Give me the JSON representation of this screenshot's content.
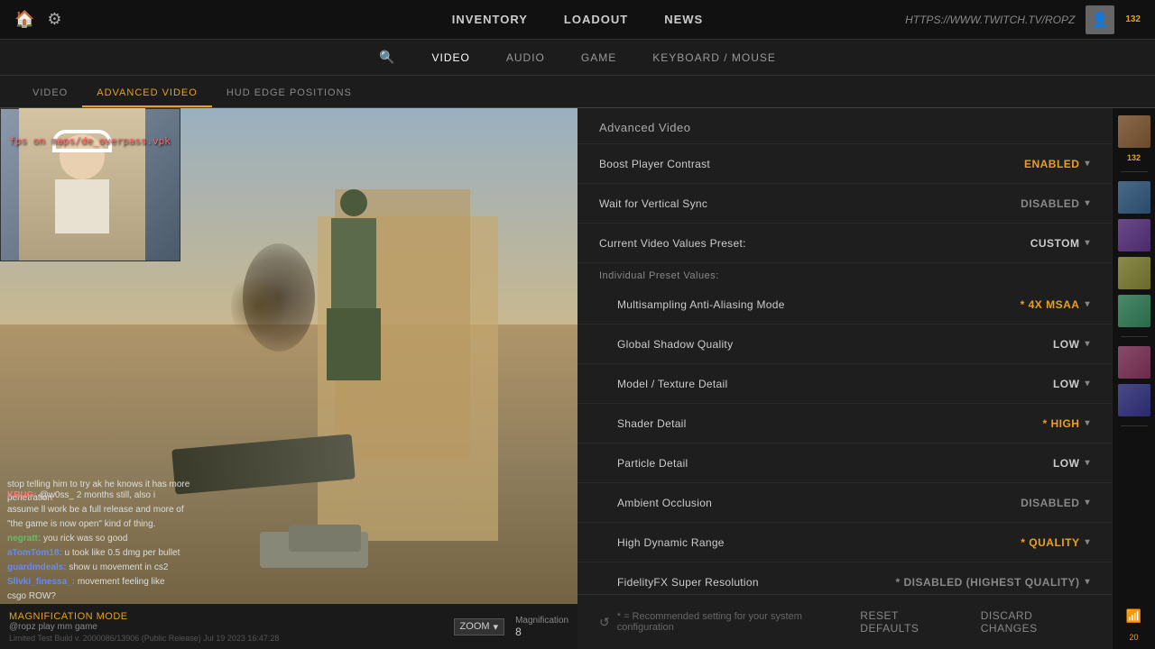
{
  "topnav": {
    "home_icon": "🏠",
    "settings_icon": "⚙",
    "nav_items": [
      {
        "label": "INVENTORY",
        "id": "inventory"
      },
      {
        "label": "LOADOUT",
        "id": "loadout"
      },
      {
        "label": "NEWS",
        "id": "news"
      }
    ],
    "twitch_url": "HTTPS://WWW.TWITCH.TV/ROPZ",
    "user_count": "132"
  },
  "settings_nav": {
    "search_icon": "🔍",
    "items": [
      {
        "label": "VIDEO",
        "id": "video",
        "active": true
      },
      {
        "label": "AUDIO",
        "id": "audio"
      },
      {
        "label": "GAME",
        "id": "game"
      },
      {
        "label": "KEYBOARD / MOUSE",
        "id": "keyboard"
      }
    ]
  },
  "tabs": [
    {
      "label": "VIDEO",
      "id": "video"
    },
    {
      "label": "ADVANCED VIDEO",
      "id": "advanced-video",
      "active": true
    },
    {
      "label": "HUD EDGE POSITIONS",
      "id": "hud-edge"
    }
  ],
  "advanced_video": {
    "section_title": "Advanced Video",
    "settings": [
      {
        "label": "Boost Player Contrast",
        "value": "ENABLED",
        "type": "enabled"
      },
      {
        "label": "Wait for Vertical Sync",
        "value": "DISABLED",
        "type": "disabled"
      },
      {
        "label": "Current Video Values Preset:",
        "value": "CUSTOM",
        "type": "custom"
      }
    ],
    "preset_label": "Individual Preset Values:",
    "preset_settings": [
      {
        "label": "Multisampling Anti-Aliasing Mode",
        "value": "* 4X MSAA",
        "type": "msaa"
      },
      {
        "label": "Global Shadow Quality",
        "value": "LOW",
        "type": "low"
      },
      {
        "label": "Model / Texture Detail",
        "value": "LOW",
        "type": "low"
      },
      {
        "label": "Shader Detail",
        "value": "* HIGH",
        "type": "high"
      },
      {
        "label": "Particle Detail",
        "value": "LOW",
        "type": "low"
      },
      {
        "label": "Ambient Occlusion",
        "value": "DISABLED",
        "type": "disabled"
      },
      {
        "label": "High Dynamic Range",
        "value": "* QUALITY",
        "type": "quality"
      },
      {
        "label": "FidelityFX Super Resolution",
        "value": "* DISABLED (HIGHEST QUALITY)",
        "type": "disabled"
      }
    ]
  },
  "footer": {
    "note": "* = Recommended setting for your system configuration",
    "reset_label": "RESET DEFAULTS",
    "discard_label": "DISCARD CHANGES",
    "reset_icon": "↺"
  },
  "stream": {
    "fps_text": "fps on maps/de_overpass.vpk",
    "game_text_line1": "stop telling him to try ak he knows it has more",
    "game_text_line2": "penetration",
    "chat": [
      {
        "user": "KRUG:",
        "color": "red",
        "msg": "@w0ss_ 2 months still, also i"
      },
      {
        "user": "",
        "color": "none",
        "msg": "assume ll work be a full release and more of"
      },
      {
        "user": "",
        "color": "none",
        "msg": "\"the game is now open\" kind of thing."
      },
      {
        "user": "negratt:",
        "color": "green",
        "msg": "you rickl was so good"
      },
      {
        "user": "aTomTom18:",
        "color": "blue",
        "msg": "u took like 0.5 dmg per bullet"
      },
      {
        "user": "guardmdeals:",
        "color": "blue",
        "msg": "show u movement in cs2"
      },
      {
        "user": "Slivki_finessa_:",
        "color": "blue",
        "msg": "movement feeling like"
      },
      {
        "user": "csgo ROW?",
        "color": "none",
        "msg": ""
      }
    ],
    "bottom_bar": {
      "mode_label": "Magnification Mode",
      "mode_sublabel": "@ropz play mm game",
      "zoom_label": "ZOOM",
      "mag_label": "Magnification",
      "mag_value": "8",
      "build_info": "Limited Test Build v. 2000086/13906 (Public Release) Jul 19 2023 16:47:28"
    }
  }
}
